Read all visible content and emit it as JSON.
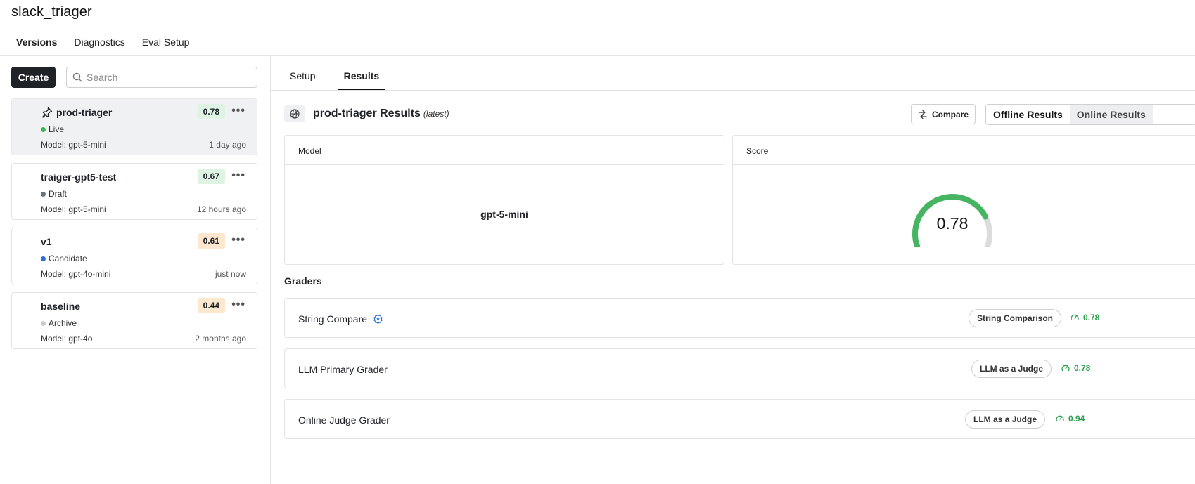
{
  "app": {
    "title": "slack_triager"
  },
  "top_tabs": [
    {
      "label": "Versions",
      "active": true
    },
    {
      "label": "Diagnostics",
      "active": false
    },
    {
      "label": "Eval Setup",
      "active": false
    }
  ],
  "sidebar": {
    "create_label": "Create",
    "search_placeholder": "Search",
    "versions": [
      {
        "name": "prod-triager",
        "score": "0.78",
        "score_color": "#dff3e4",
        "status": "Live",
        "status_color": "#3fb45a",
        "model": "Model: gpt-5-mini",
        "time": "1 day ago",
        "pinned": true,
        "selected": true
      },
      {
        "name": "traiger-gpt5-test",
        "score": "0.67",
        "score_color": "#dff3e4",
        "status": "Draft",
        "status_color": "#6b7280",
        "model": "Model: gpt-5-mini",
        "time": "12 hours ago",
        "pinned": false,
        "selected": false
      },
      {
        "name": "v1",
        "score": "0.61",
        "score_color": "#fde7cf",
        "status": "Candidate",
        "status_color": "#2f6fd6",
        "model": "Model: gpt-4o-mini",
        "time": "just now",
        "pinned": false,
        "selected": false
      },
      {
        "name": "baseline",
        "score": "0.44",
        "score_color": "#fde7cf",
        "status": "Archive",
        "status_color": "#c9cbd0",
        "model": "Model: gpt-4o",
        "time": "2 months ago",
        "pinned": false,
        "selected": false
      }
    ]
  },
  "main": {
    "sub_tabs": [
      {
        "label": "Setup",
        "active": false
      },
      {
        "label": "Results",
        "active": true
      }
    ],
    "results_title": "prod-triager Results",
    "results_tag": "(latest)",
    "compare_label": "Compare",
    "segments": [
      {
        "label": "Offline Results",
        "active": true
      },
      {
        "label": "Online Results",
        "active": false
      }
    ],
    "model_panel": {
      "header": "Model",
      "value": "gpt-5-mini"
    },
    "score_panel": {
      "header": "Score",
      "value": "0.78",
      "gauge_fraction": 0.78,
      "gauge_color": "#46b562",
      "gauge_track": "#dcdcdc"
    },
    "graders_title": "Graders",
    "graders": [
      {
        "name": "String Compare",
        "badge_icon": true,
        "type": "String Comparison",
        "score": "0.78"
      },
      {
        "name": "LLM Primary Grader",
        "badge_icon": false,
        "type": "LLM as a Judge",
        "score": "0.78"
      },
      {
        "name": "Online Judge Grader",
        "badge_icon": false,
        "type": "LLM as a Judge",
        "score": "0.94"
      }
    ]
  }
}
